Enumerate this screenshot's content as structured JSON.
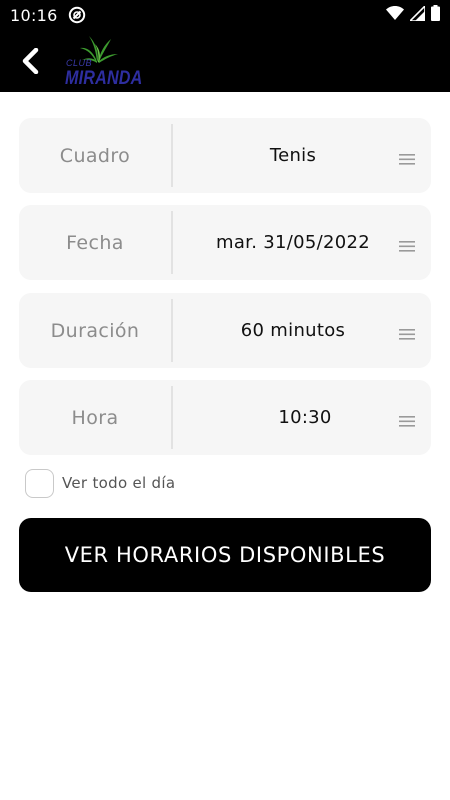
{
  "status_bar": {
    "time": "10:16",
    "icons": [
      "notification-icon",
      "wifi-icon",
      "signal-icon",
      "battery-icon"
    ]
  },
  "app_bar": {
    "back_icon": "chevron-left-icon",
    "logo": {
      "small_text": "CLUB",
      "brand_text": "MIRANDA"
    }
  },
  "form": {
    "fields": [
      {
        "label": "Cuadro",
        "value": "Tenis"
      },
      {
        "label": "Fecha",
        "value": "mar. 31/05/2022"
      },
      {
        "label": "Duración",
        "value": "60 minutos"
      },
      {
        "label": "Hora",
        "value": "10:30"
      }
    ],
    "all_day_checkbox": {
      "label": "Ver todo el día",
      "checked": false
    },
    "submit_label": "VER HORARIOS DISPONIBLES"
  },
  "colors": {
    "bar_background": "#000000",
    "field_background": "#f6f6f6",
    "label_color": "#8c8c8c",
    "button_background": "#000000",
    "logo_blue": "#2e2ea0",
    "logo_green": "#3c9a2e"
  }
}
